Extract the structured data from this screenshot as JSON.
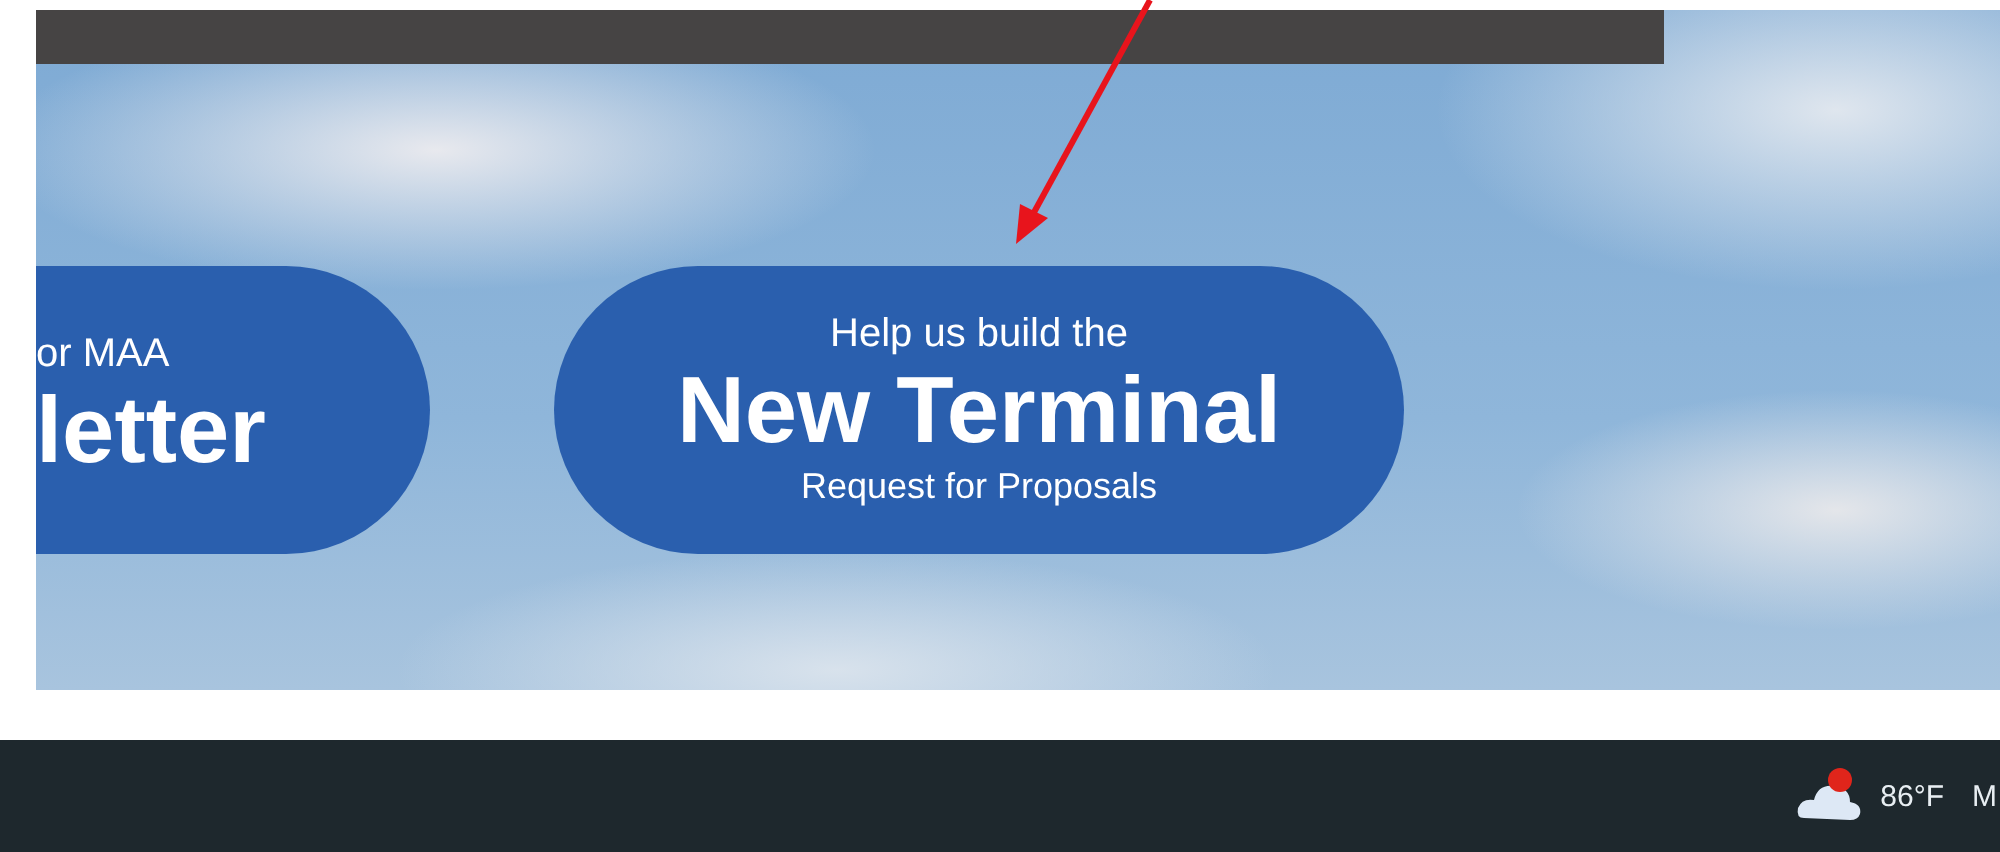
{
  "banners": [
    {
      "kind": "partial",
      "line_1": "or MAA",
      "line_2": "letter"
    },
    {
      "kind": "full",
      "line_1": "Help us build the",
      "line_2": "New Terminal",
      "line_3": "Request for Proposals"
    }
  ],
  "taskbar": {
    "weather": {
      "temperature": "86°F",
      "alert": true
    },
    "clock_partial": "M"
  }
}
